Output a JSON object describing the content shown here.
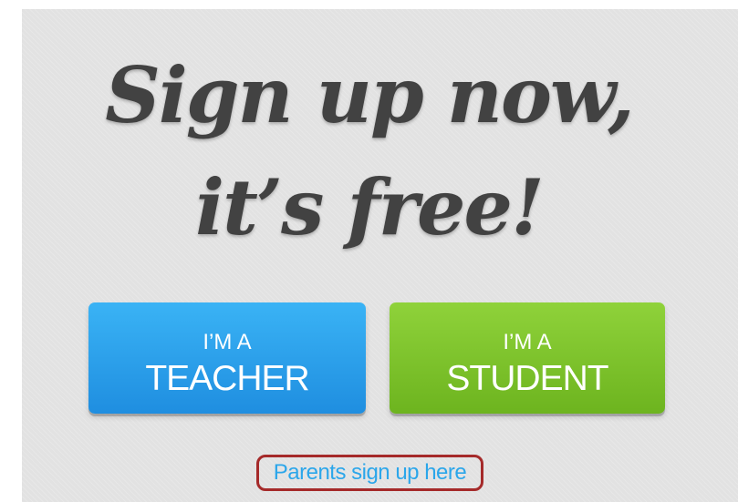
{
  "headline": {
    "line1": "Sign up now,",
    "line2": "it’s free!"
  },
  "buttons": {
    "teacher": {
      "small": "I’M A",
      "big": "TEACHER"
    },
    "student": {
      "small": "I’M A",
      "big": "STUDENT"
    }
  },
  "parents_link": "Parents sign up here",
  "colors": {
    "teacher_button": "#2aa0ea",
    "student_button": "#7cc22b",
    "link": "#2ba6ea",
    "highlight_box": "#a52a2a",
    "headline_text": "#424242"
  }
}
